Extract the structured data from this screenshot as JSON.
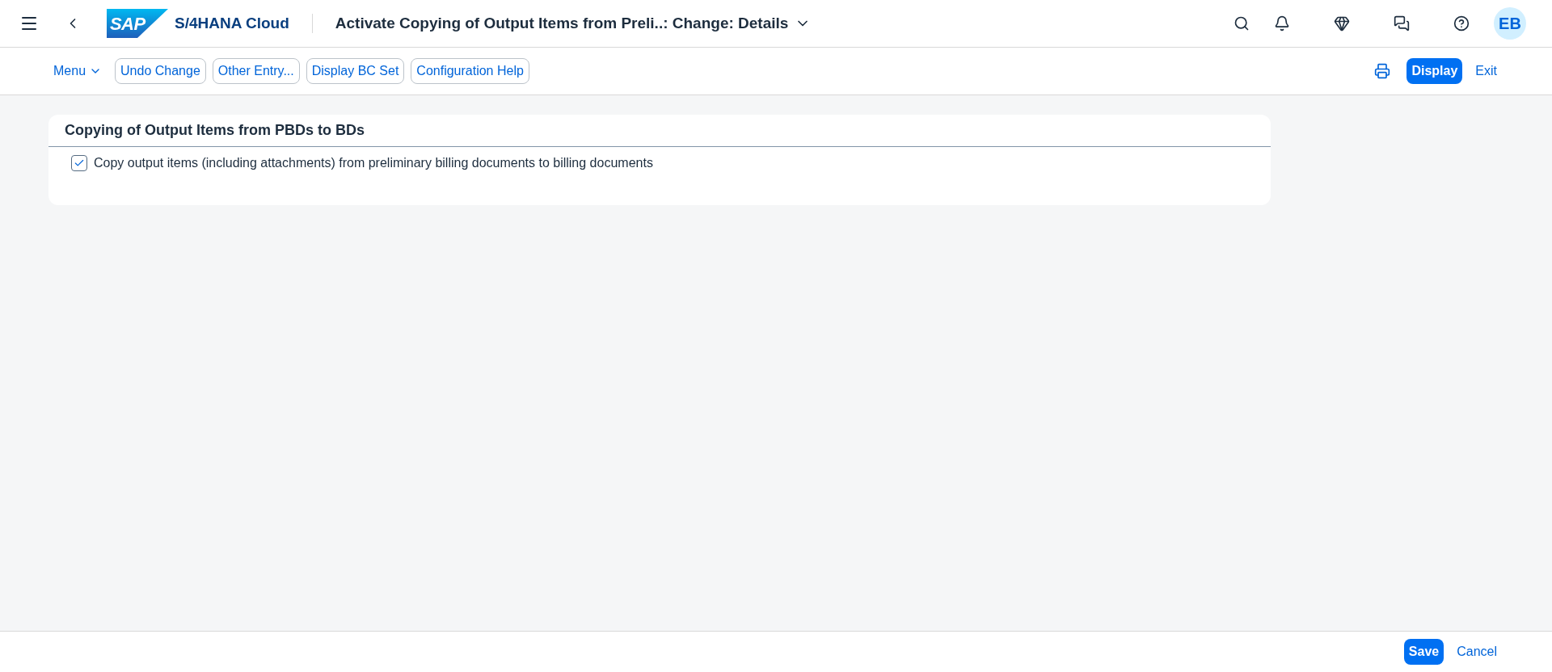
{
  "shell": {
    "logo_text": "SAP",
    "product": "S/4HANA Cloud",
    "title": "Activate Copying of Output Items from Preli..: Change: Details",
    "avatar": "EB"
  },
  "toolbar": {
    "left": [
      {
        "label": "Menu",
        "kind": "menu"
      },
      {
        "label": "Undo Change",
        "kind": "outlined"
      },
      {
        "label": "Other Entry...",
        "kind": "outlined"
      },
      {
        "label": "Display BC Set",
        "kind": "outlined"
      },
      {
        "label": "Configuration Help",
        "kind": "outlined"
      }
    ],
    "right": [
      {
        "label": "Display",
        "kind": "emphasized"
      },
      {
        "label": "Exit",
        "kind": "transparent"
      }
    ]
  },
  "section": {
    "title": "Copying of Output Items from PBDs to BDs",
    "checkbox": {
      "label": "Copy output items (including attachments) from preliminary billing documents to billing documents",
      "checked": true
    }
  },
  "footer": [
    {
      "label": "Save",
      "kind": "emphasized"
    },
    {
      "label": "Cancel",
      "kind": "transparent"
    }
  ]
}
